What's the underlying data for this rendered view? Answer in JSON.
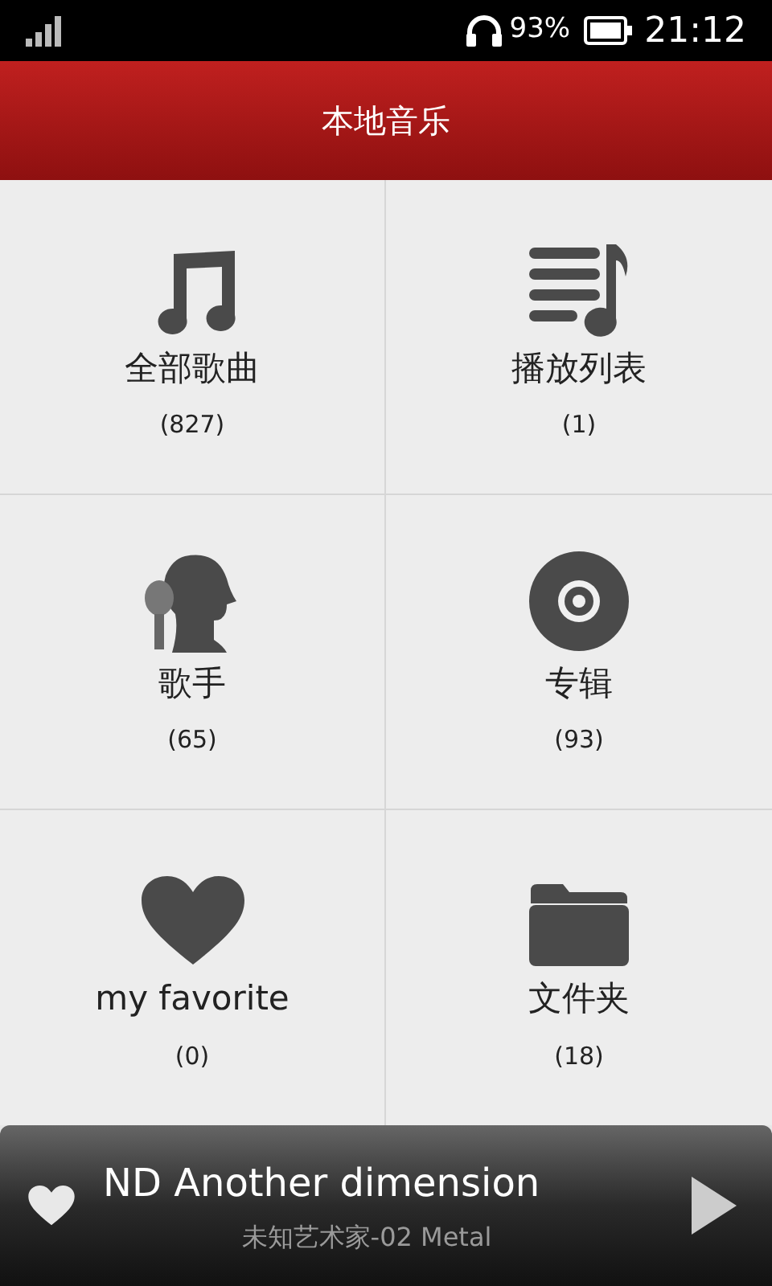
{
  "status_bar": {
    "battery": "93%",
    "time": "21:12"
  },
  "header": {
    "title": "本地音乐"
  },
  "tiles": [
    {
      "kind": "note",
      "label": "全部歌曲",
      "count": "(827)"
    },
    {
      "kind": "playlist",
      "label": "播放列表",
      "count": "(1)"
    },
    {
      "kind": "singer",
      "label": "歌手",
      "count": "(65)"
    },
    {
      "kind": "disc",
      "label": "专辑",
      "count": "(93)"
    },
    {
      "kind": "heart",
      "label": "my favorite",
      "count": "(0)"
    },
    {
      "kind": "folder",
      "label": "文件夹",
      "count": "(18)"
    }
  ],
  "now_playing": {
    "title": "ND Another dimension",
    "subtitle": "未知艺术家-02 Metal"
  }
}
